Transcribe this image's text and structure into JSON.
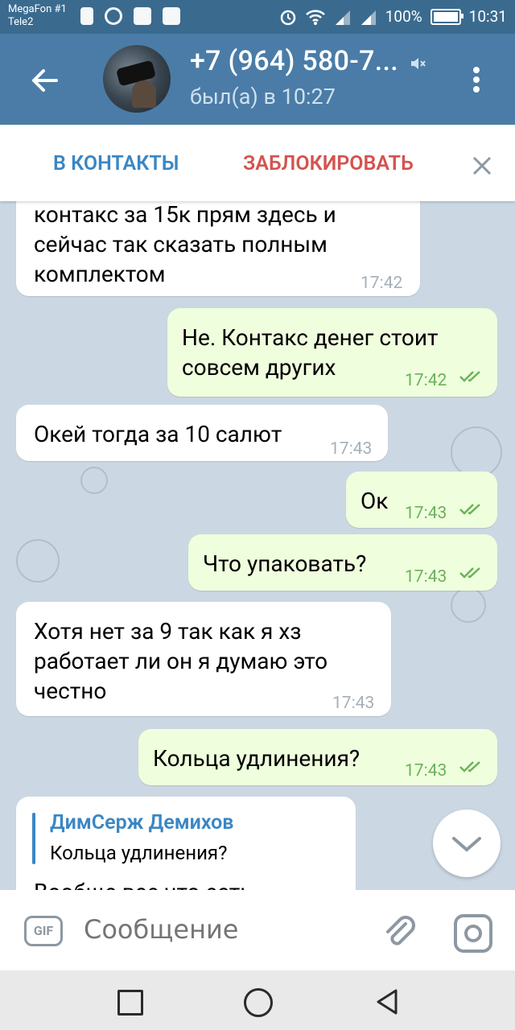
{
  "status_bar": {
    "carrier1": "MegaFon #1",
    "carrier2": "Tele2",
    "battery": "100%",
    "time": "10:31"
  },
  "header": {
    "contact_name": "+7 (964) 580-7...",
    "last_seen": "был(а) в 10:27"
  },
  "action_bar": {
    "add_contact": "В КОНТАКТЫ",
    "block": "ЗАБЛОКИРОВАТЬ"
  },
  "messages": [
    {
      "dir": "in",
      "lines": [
        "контакс за 15к прям здесь и",
        "сейчас так сказать полным",
        "комплектом"
      ],
      "time": "17:42"
    },
    {
      "dir": "out",
      "lines": [
        "Не. Контакс денег стоит",
        "совсем других"
      ],
      "time": "17:42"
    },
    {
      "dir": "in",
      "lines": [
        "Окей тогда за 10 салют"
      ],
      "time": "17:43"
    },
    {
      "dir": "out",
      "lines": [
        "Ок"
      ],
      "time": "17:43"
    },
    {
      "dir": "out",
      "lines": [
        "Что упаковать?"
      ],
      "time": "17:43"
    },
    {
      "dir": "in",
      "lines": [
        "Хотя нет за 9 так как я хз",
        "работает ли он я думаю это",
        "честно"
      ],
      "time": "17:43"
    },
    {
      "dir": "out",
      "lines": [
        "Кольца удлинения?"
      ],
      "time": "17:43"
    },
    {
      "dir": "in",
      "reply_name": "ДимСерж Демихов",
      "reply_text": "Кольца удлинения?",
      "lines": [
        "Вообще все что есть"
      ],
      "time": ""
    }
  ],
  "input": {
    "gif": "GIF",
    "placeholder": "Сообщение"
  },
  "colors": {
    "header": "#4a7ca7",
    "accent": "#3a86c4",
    "danger": "#d5534f",
    "outgoing_bubble": "#effedd",
    "read_check": "#6bb35a"
  }
}
